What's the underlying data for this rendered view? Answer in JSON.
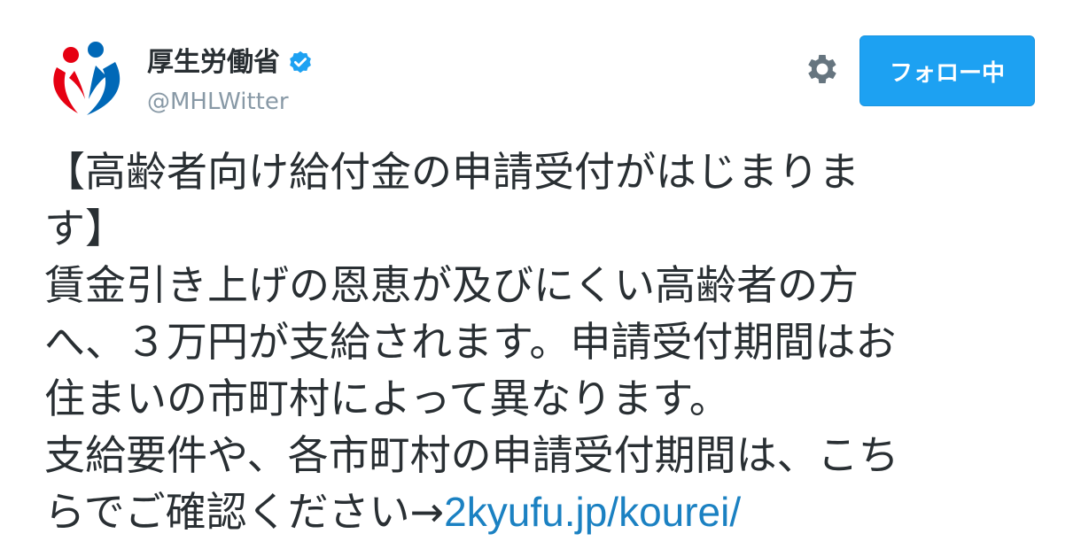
{
  "account": {
    "display_name": "厚生労働省",
    "handle": "@MHLWitter",
    "verified": true
  },
  "actions": {
    "follow_label": "フォロー中"
  },
  "tweet": {
    "lines": [
      "【高齢者向け給付金の申請受付がはじまりま",
      "す】",
      "賃金引き上げの恩恵が及びにくい高齢者の方",
      "へ、３万円が支給されます。申請受付期間はお",
      "住まいの市町村によって異なります。",
      "支給要件や、各市町村の申請受付期間は、こち"
    ],
    "last_line_prefix": "らでご確認ください→",
    "link_text": "2kyufu.jp/kourei/"
  },
  "colors": {
    "follow_button": "#1da1f2",
    "link": "#1b81c2",
    "verified_badge": "#1da1f2",
    "handle": "#8899a6",
    "logo_red": "#e60012",
    "logo_blue": "#0068b7"
  },
  "icons": {
    "avatar": "mhlw-logo-icon",
    "verified": "verified-badge-icon",
    "settings": "gear-icon"
  }
}
